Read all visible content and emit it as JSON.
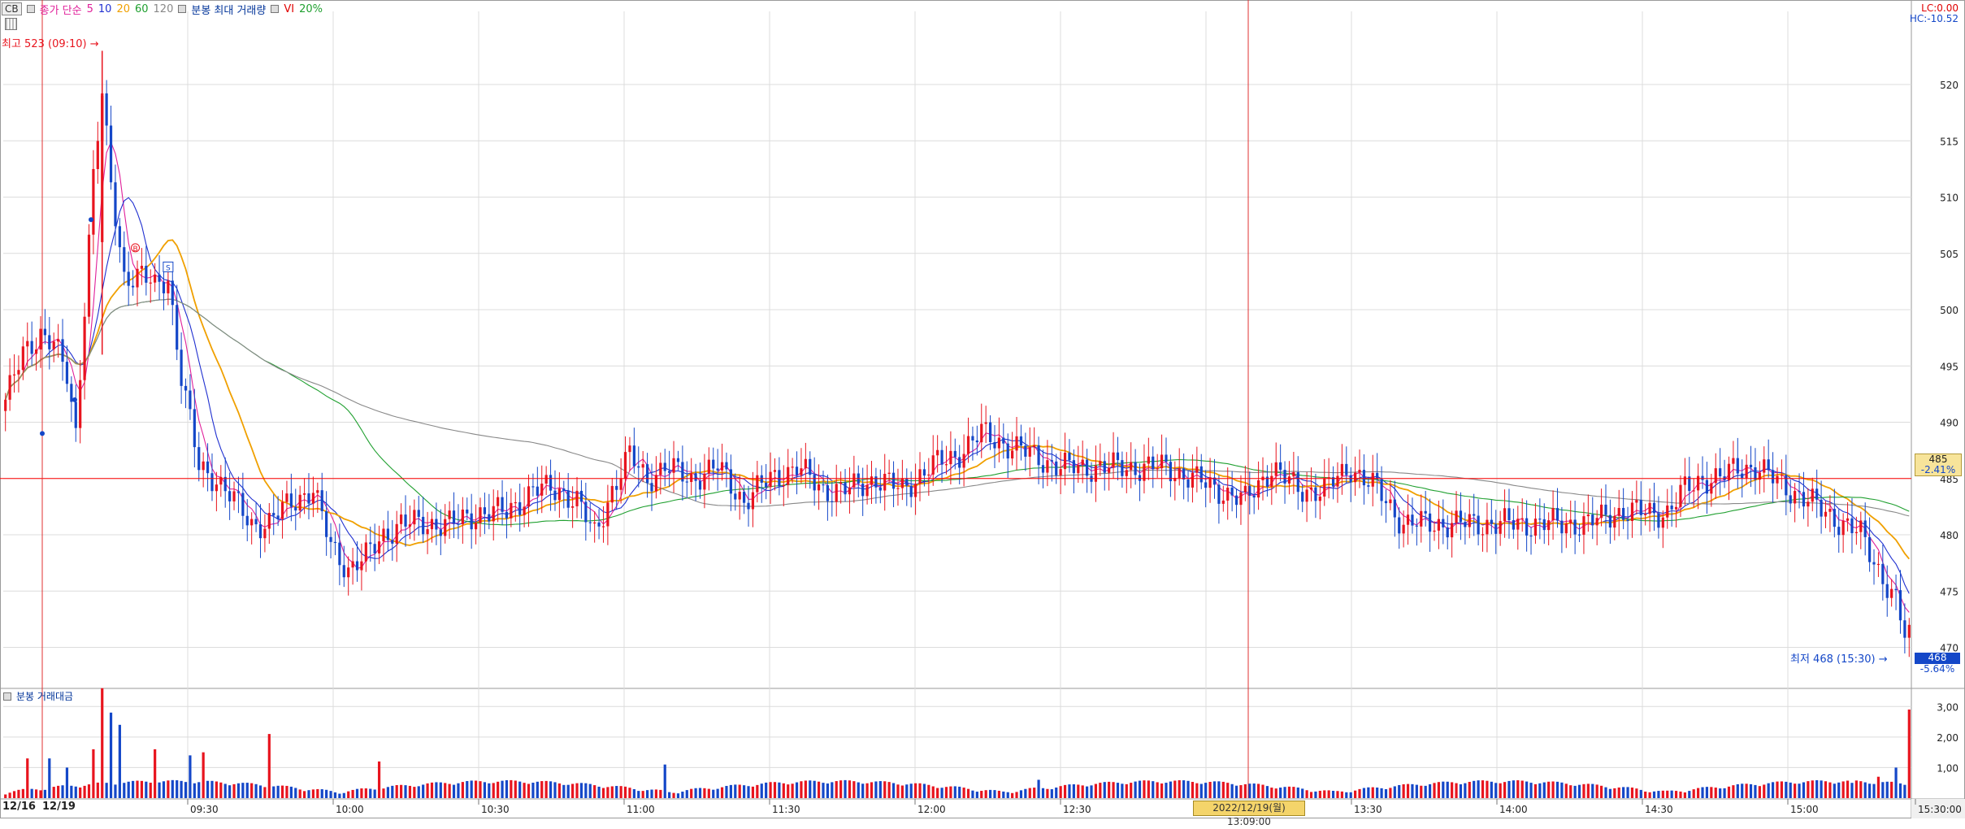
{
  "legend": {
    "cb": "CB",
    "ma_label": "종가 단순",
    "ma_periods": [
      "5",
      "10",
      "20",
      "60",
      "120"
    ],
    "ma_colors": [
      "#e0209a",
      "#2030d0",
      "#f0a000",
      "#20a030",
      "#888888"
    ],
    "vol_label": "분봉 최대 거래량",
    "vi_label": "VI",
    "vi_value": "20%"
  },
  "top_right": {
    "lc": "LC:0.00",
    "hc": "HC:-10.52"
  },
  "annotations": {
    "high": "최고 523 (09:10)",
    "low": "최저 468 (15:30)",
    "marker_b": "B",
    "marker_s": "S"
  },
  "current": {
    "price": "485",
    "change": "-2.41%"
  },
  "low_tag": {
    "price": "468",
    "change": "-5.64%"
  },
  "volume_panel": {
    "title": "분봉 거래대금"
  },
  "crosshair": {
    "label": "2022/12/19(월) 13:09:00"
  },
  "dates": {
    "prev": "12/16",
    "curr": "12/19"
  },
  "colors": {
    "up": "#e8141e",
    "down": "#1447c8",
    "grid": "#dcdcdc",
    "hline": "#ff0000"
  },
  "chart_data": {
    "type": "candlestick",
    "title": "",
    "y_axis": {
      "ticks": [
        470,
        475,
        480,
        485,
        490,
        495,
        500,
        505,
        510,
        515,
        520
      ],
      "range": [
        466.5,
        526.5
      ]
    },
    "volume_axis": {
      "ticks": [
        "1,00",
        "2,00",
        "3,00"
      ],
      "range": [
        0,
        3.3
      ]
    },
    "x_ticks": [
      "09:30",
      "10:00",
      "10:30",
      "11:00",
      "11:30",
      "12:00",
      "12:30",
      "13:00",
      "13:30",
      "14:00",
      "14:30",
      "15:00",
      "15:30:00"
    ],
    "anchors": [
      [
        0,
        492
      ],
      [
        4,
        496
      ],
      [
        8,
        498
      ],
      [
        11,
        497
      ],
      [
        14,
        494
      ],
      [
        16,
        489
      ],
      [
        20,
        512
      ],
      [
        22,
        519
      ],
      [
        24,
        511
      ],
      [
        27,
        503
      ],
      [
        31,
        503
      ],
      [
        34,
        502
      ],
      [
        37,
        503
      ],
      [
        40,
        494
      ],
      [
        44,
        486
      ],
      [
        48,
        485
      ],
      [
        52,
        483
      ],
      [
        56,
        481
      ],
      [
        60,
        481
      ],
      [
        65,
        483
      ],
      [
        70,
        484
      ],
      [
        74,
        479
      ],
      [
        78,
        477
      ],
      [
        82,
        478
      ],
      [
        86,
        480
      ],
      [
        90,
        481
      ],
      [
        96,
        481
      ],
      [
        102,
        481
      ],
      [
        108,
        482
      ],
      [
        114,
        482
      ],
      [
        120,
        484
      ],
      [
        126,
        484
      ],
      [
        130,
        483
      ],
      [
        134,
        480
      ],
      [
        138,
        484
      ],
      [
        142,
        487
      ],
      [
        146,
        485
      ],
      [
        150,
        486
      ],
      [
        156,
        485
      ],
      [
        162,
        486
      ],
      [
        168,
        483
      ],
      [
        174,
        485
      ],
      [
        180,
        486
      ],
      [
        186,
        484
      ],
      [
        192,
        484
      ],
      [
        198,
        485
      ],
      [
        204,
        484
      ],
      [
        210,
        486
      ],
      [
        216,
        487
      ],
      [
        222,
        489
      ],
      [
        228,
        488
      ],
      [
        234,
        487
      ],
      [
        240,
        486
      ],
      [
        246,
        486
      ],
      [
        252,
        486
      ],
      [
        258,
        486
      ],
      [
        264,
        486
      ],
      [
        270,
        485
      ],
      [
        276,
        484
      ],
      [
        282,
        483
      ],
      [
        288,
        486
      ],
      [
        294,
        484
      ],
      [
        300,
        484
      ],
      [
        306,
        486
      ],
      [
        312,
        484
      ],
      [
        318,
        481
      ],
      [
        324,
        481
      ],
      [
        330,
        481
      ],
      [
        336,
        481
      ],
      [
        342,
        481
      ],
      [
        348,
        481
      ],
      [
        354,
        481
      ],
      [
        360,
        481
      ],
      [
        366,
        482
      ],
      [
        372,
        482
      ],
      [
        378,
        482
      ],
      [
        382,
        484
      ],
      [
        386,
        485
      ],
      [
        390,
        485
      ],
      [
        394,
        486
      ],
      [
        398,
        486
      ],
      [
        402,
        485
      ],
      [
        406,
        484
      ],
      [
        410,
        483
      ],
      [
        414,
        482
      ],
      [
        418,
        481
      ],
      [
        422,
        480
      ],
      [
        426,
        477
      ],
      [
        430,
        474
      ],
      [
        432,
        471
      ]
    ],
    "volume_spikes": [
      [
        5,
        1.3
      ],
      [
        10,
        1.3
      ],
      [
        14,
        1.0
      ],
      [
        20,
        1.6
      ],
      [
        22,
        3.6
      ],
      [
        24,
        2.8
      ],
      [
        26,
        2.4
      ],
      [
        34,
        1.6
      ],
      [
        42,
        1.4
      ],
      [
        45,
        1.5
      ],
      [
        60,
        2.1
      ],
      [
        85,
        1.2
      ],
      [
        150,
        1.1
      ],
      [
        235,
        0.6
      ],
      [
        420,
        0.5
      ],
      [
        426,
        0.7
      ],
      [
        430,
        1.0
      ],
      [
        433,
        2.9
      ]
    ],
    "high": {
      "value": 523,
      "time": "09:10"
    },
    "low": {
      "value": 468,
      "time": "15:30"
    },
    "reference_line": 485
  }
}
